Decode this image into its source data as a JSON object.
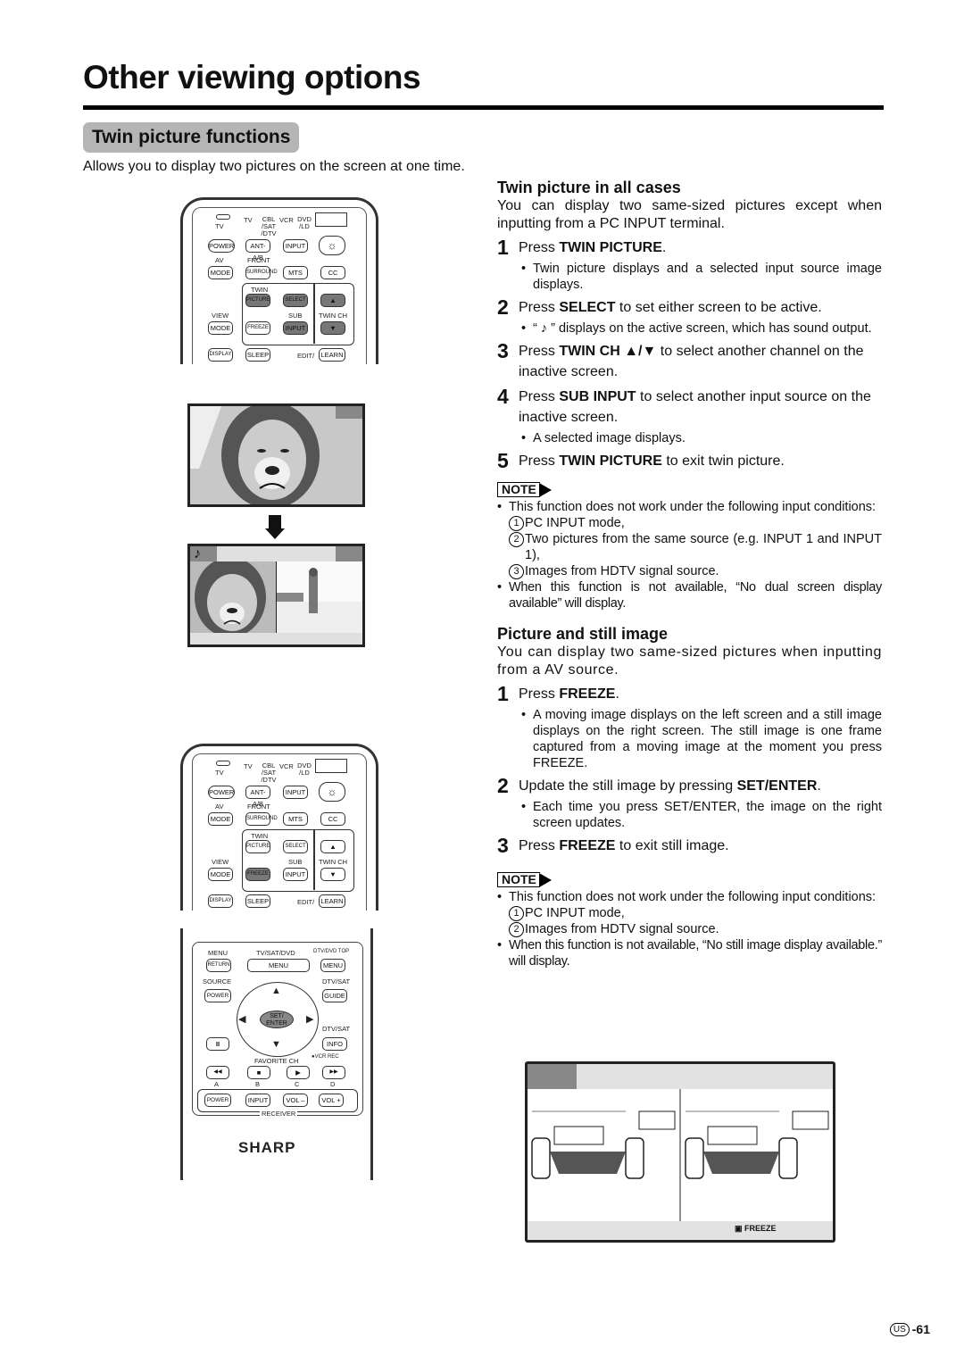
{
  "page": {
    "title": "Other viewing options",
    "section_tab": "Twin picture functions",
    "intro": "Allows you to display two pictures on the screen at one time.",
    "page_number": {
      "region_badge": "US",
      "number": "-61"
    }
  },
  "twin_all": {
    "heading": "Twin picture in all cases",
    "desc": "You can display two same-sized pictures except when inputting from a PC INPUT terminal.",
    "steps": [
      {
        "num": "1",
        "pre": "Press ",
        "bold": "TWIN PICTURE",
        "post": ".",
        "bullets": [
          "Twin picture displays and a selected input source image displays."
        ]
      },
      {
        "num": "2",
        "pre": "Press ",
        "bold": "SELECT",
        "post": " to set either screen to be active.",
        "bullets": [
          "“ ♪ ” displays on the active screen, which has sound output."
        ]
      },
      {
        "num": "3",
        "pre": "Press ",
        "bold": "TWIN CH ▲/▼",
        "post": " to select another channel on the inactive screen.",
        "bullets": []
      },
      {
        "num": "4",
        "pre": "Press ",
        "bold": "SUB INPUT",
        "post": " to select another input source on the inactive screen.",
        "bullets": [
          "A selected image displays."
        ]
      },
      {
        "num": "5",
        "pre": "Press ",
        "bold": "TWIN PICTURE",
        "post": " to exit twin picture.",
        "bullets": []
      }
    ],
    "note": {
      "label": "NOTE",
      "intro": "This function does not work under the following input conditions:",
      "conditions": [
        {
          "n": "1",
          "text": "PC INPUT mode,"
        },
        {
          "n": "2",
          "text": "Two pictures from the same source (e.g. INPUT 1 and INPUT 1),"
        },
        {
          "n": "3",
          "text": "Images from HDTV signal source."
        }
      ],
      "fallback": "When this function is not available, “No dual screen display available” will display."
    }
  },
  "still": {
    "heading": "Picture and still image",
    "desc": "You can display two same-sized pictures when inputting from a AV source.",
    "steps": [
      {
        "num": "1",
        "pre": "Press ",
        "bold": "FREEZE",
        "post": ".",
        "bullets": [
          "A moving image displays on the left screen and a still image displays on the right screen. The still image is one frame captured from a moving image at the moment you press FREEZE."
        ]
      },
      {
        "num": "2",
        "pre": "Update the still image by pressing ",
        "bold": "SET/ENTER",
        "post": ".",
        "bullets": [
          "Each time you press SET/ENTER, the image on the right screen updates."
        ]
      },
      {
        "num": "3",
        "pre": "Press ",
        "bold": "FREEZE",
        "post": " to exit still image.",
        "bullets": []
      }
    ],
    "note": {
      "label": "NOTE",
      "intro": "This function does not work under the following input conditions:",
      "conditions": [
        {
          "n": "1",
          "text": "PC INPUT mode,"
        },
        {
          "n": "2",
          "text": "Images from HDTV signal source."
        }
      ],
      "fallback": "When this function is not available, “No still image display available.” will display."
    }
  },
  "remote": {
    "source_labels": [
      "TV",
      "CBL /SAT /DTV",
      "VCR",
      "DVD /LD"
    ],
    "tv_label": "TV",
    "power": "POWER",
    "ant": "ANT-A/B",
    "input": "INPUT",
    "av_label": "AV",
    "mode": "MODE",
    "front_label": "FRONT",
    "surround": "SURROUND",
    "mts": "MTS",
    "cc": "CC",
    "twin_label": "TWIN",
    "picture": "PICTURE",
    "select": "SELECT",
    "view_label": "VIEW",
    "sub_label": "SUB",
    "twinch_label": "TWIN CH",
    "freeze": "FREEZE",
    "up": "▲",
    "down": "▼",
    "display": "DISPLAY",
    "sleep": "SLEEP",
    "edit_label": "EDIT/",
    "learn": "LEARN",
    "highlight_top": [
      "PICTURE",
      "SELECT",
      "SUB INPUT",
      "TWIN CH"
    ],
    "highlight_bottom": [
      "FREEZE",
      "SET/ENTER"
    ],
    "lower": {
      "menu_label": "MENU",
      "return": "RETURN",
      "tvsat_label": "TV/SAT/DVD",
      "menu": "MENU",
      "dtvtop_label": "DTV/DVD TOP",
      "topmenu": "MENU",
      "source_label": "SOURCE",
      "power": "POWER",
      "dtvsat_label": "DTV/SAT",
      "guide": "GUIDE",
      "set_enter": "SET/ ENTER",
      "dtvsat2_label": "DTV/SAT",
      "pause": "II",
      "info": "INFO",
      "favorite_label": "FAVORITE CH",
      "vcrrec_label": "●VCR REC",
      "transport": [
        "◀◀",
        "■",
        "▶",
        "▶▶"
      ],
      "transport_labels": [
        "A",
        "B",
        "C",
        "D"
      ],
      "receiver_power": "POWER",
      "receiver_input": "INPUT",
      "vol_minus": "VOL –",
      "vol_plus": "VOL +",
      "receiver_label": "RECEIVER",
      "brand": "SHARP"
    }
  },
  "illustrations": {
    "sound_icon": "♪",
    "freeze_label": "FREEZE"
  }
}
